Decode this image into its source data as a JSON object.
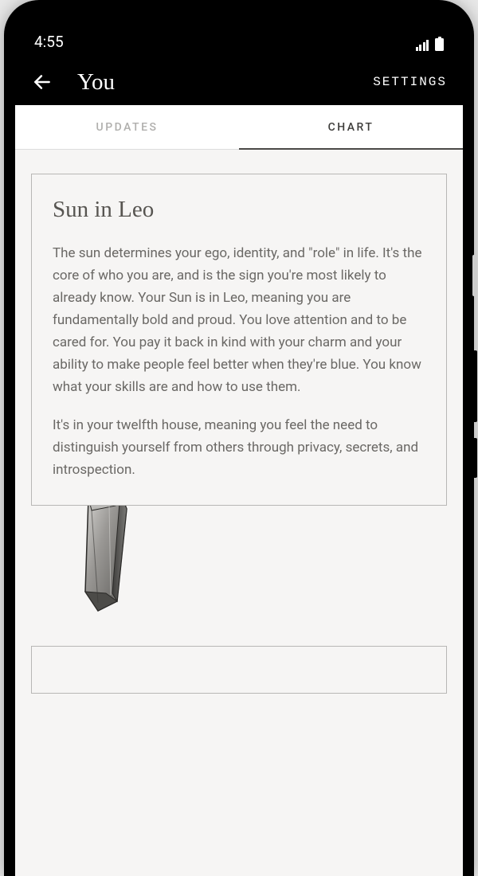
{
  "status_bar": {
    "time": "4:55"
  },
  "header": {
    "title": "You",
    "settings_label": "SETTINGS"
  },
  "tabs": {
    "updates": "UPDATES",
    "chart": "CHART",
    "active": "chart"
  },
  "card": {
    "title": "Sun in Leo",
    "p1": "The sun determines your ego, identity, and \"role\" in life. It's the core of who you are, and is the sign you're most likely to already know. Your Sun is in Leo, meaning you are fundamentally bold and proud. You love attention and to be cared for. You pay it back in kind with your charm and your ability to make people feel better when they're blue. You know what your skills are and how to use them.",
    "p2": "It's in your twelfth house, meaning you feel the need to distinguish yourself from others through privacy, secrets, and introspection."
  }
}
